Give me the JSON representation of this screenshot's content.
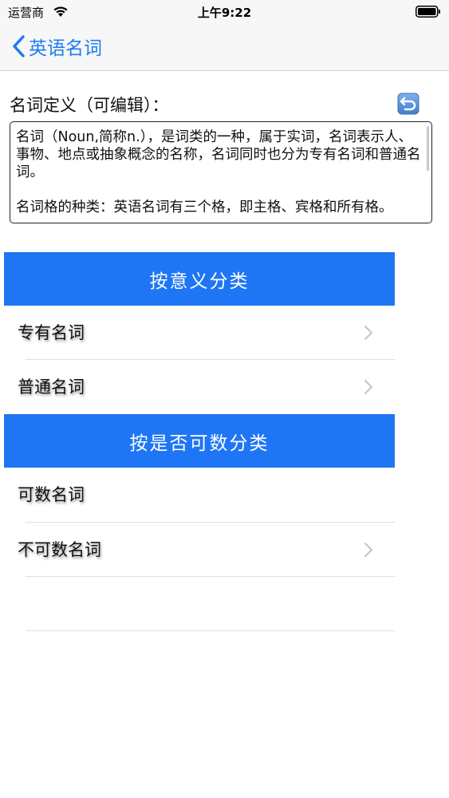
{
  "status_bar": {
    "carrier": "运营商",
    "time": "上午9:22"
  },
  "nav": {
    "back_label": "英语名词"
  },
  "definition": {
    "title": "名词定义（可编辑）：",
    "text": "名词（Noun,简称n.），是词类的一种，属于实词，名词表示人、事物、地点或抽象概念的名称，名词同时也分为专有名词和普通名词。\n\n名词格的种类：英语名词有三个格，即主格、宾格和所有格。"
  },
  "sections": [
    {
      "header": "按意义分类",
      "rows": [
        {
          "label": "专有名词",
          "has_chevron": true
        },
        {
          "label": "普通名词",
          "has_chevron": true
        }
      ]
    },
    {
      "header": "按是否可数分类",
      "rows": [
        {
          "label": "可数名词",
          "has_chevron": false
        },
        {
          "label": "不可数名词",
          "has_chevron": true
        }
      ]
    }
  ],
  "colors": {
    "accent": "#1a7cf4",
    "section_header_bg": "#1f76f5",
    "separator": "#e0e0e0"
  }
}
